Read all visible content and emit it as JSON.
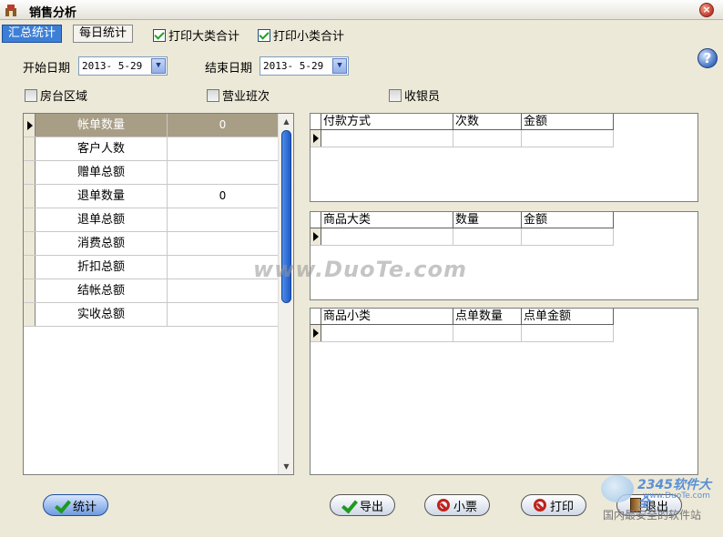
{
  "window": {
    "title": "销售分析"
  },
  "tabs": [
    {
      "label": "汇总统计"
    },
    {
      "label": "每日统计"
    }
  ],
  "options": {
    "print_category_total": {
      "label": "打印大类合计",
      "checked": true
    },
    "print_subcategory_total": {
      "label": "打印小类合计",
      "checked": true
    }
  },
  "dates": {
    "start_label": "开始日期",
    "start_value": "2013- 5-29",
    "end_label": "结束日期",
    "end_value": "2013- 5-29"
  },
  "filters": [
    {
      "label": "房台区域",
      "checked": false
    },
    {
      "label": "营业班次",
      "checked": false
    },
    {
      "label": "收银员",
      "checked": false
    }
  ],
  "summary_rows": [
    {
      "name": "帐单数量",
      "value": "0"
    },
    {
      "name": "客户人数",
      "value": ""
    },
    {
      "name": "赠单总额",
      "value": ""
    },
    {
      "name": "退单数量",
      "value": "0"
    },
    {
      "name": "退单总额",
      "value": ""
    },
    {
      "name": "消费总额",
      "value": ""
    },
    {
      "name": "折扣总额",
      "value": ""
    },
    {
      "name": "结帐总额",
      "value": ""
    },
    {
      "name": "实收总额",
      "value": ""
    }
  ],
  "payment_grid": {
    "columns": [
      "付款方式",
      "次数",
      "金额"
    ]
  },
  "category_grid": {
    "columns": [
      "商品大类",
      "数量",
      "金额"
    ]
  },
  "subcategory_grid": {
    "columns": [
      "商品小类",
      "点单数量",
      "点单金额"
    ]
  },
  "buttons": {
    "stat": "统计",
    "export": "导出",
    "receipt": "小票",
    "print": "打印",
    "exit": "退出"
  },
  "watermark": "www.DuoTe.com",
  "corner_logo": {
    "brand": "2345软件大全",
    "site": "www.DuoTe.com",
    "tagline": "国内最安全的软件站"
  }
}
